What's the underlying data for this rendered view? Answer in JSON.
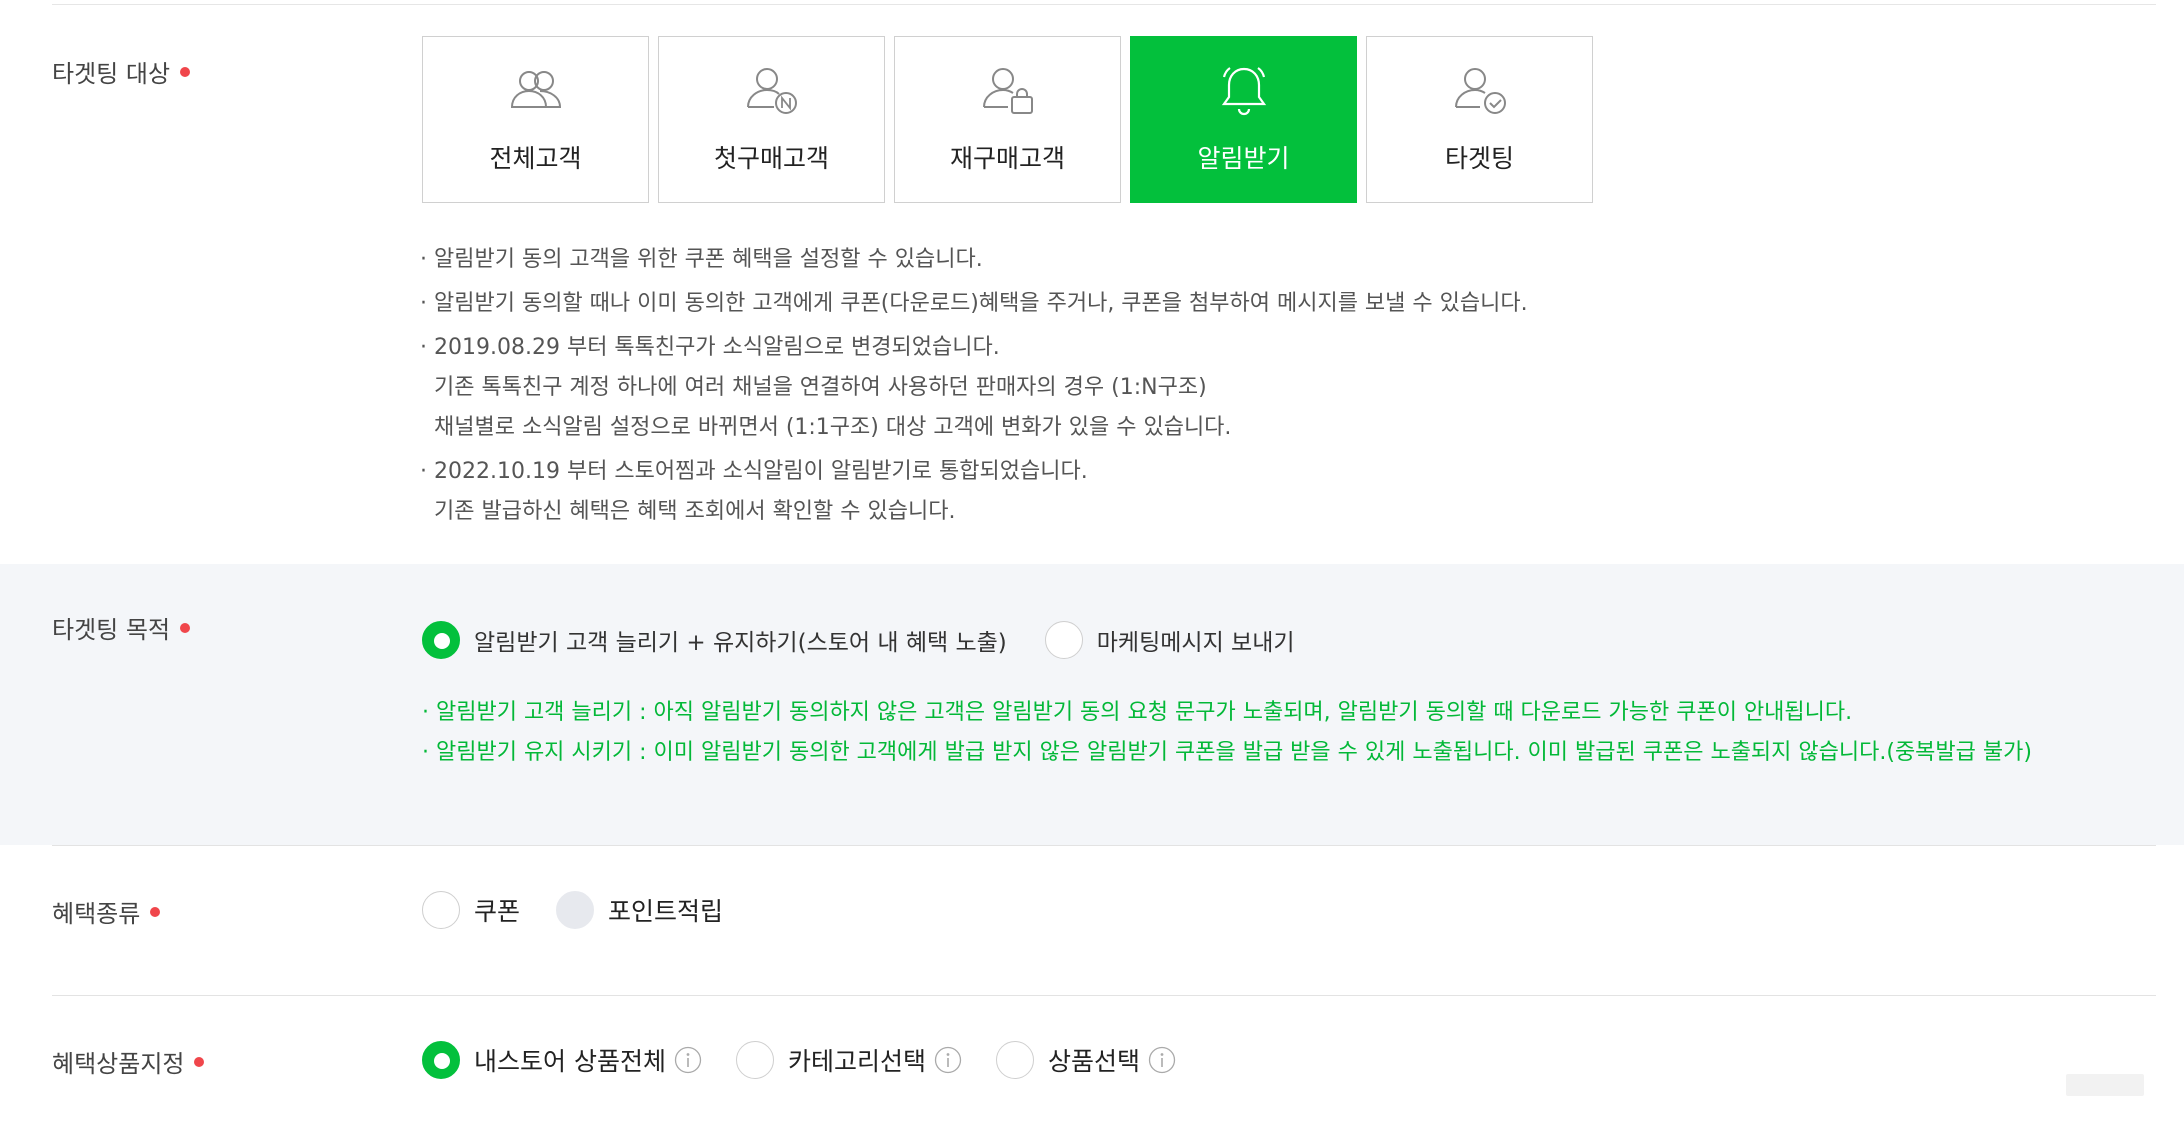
{
  "targeting_target": {
    "label": "타겟팅 대상",
    "cards": [
      {
        "label": "전체고객",
        "icon": "users-icon",
        "active": false
      },
      {
        "label": "첫구매고객",
        "icon": "user-new-icon",
        "active": false
      },
      {
        "label": "재구매고객",
        "icon": "user-bag-icon",
        "active": false
      },
      {
        "label": "알림받기",
        "icon": "bell-icon",
        "active": true
      },
      {
        "label": "타겟팅",
        "icon": "user-check-icon",
        "active": false
      }
    ],
    "notes": [
      "알림받기 동의 고객을 위한 쿠폰 혜택을 설정할 수 있습니다.",
      "알림받기 동의할 때나 이미 동의한 고객에게 쿠폰(다운로드)혜택을 주거나, 쿠폰을 첨부하여 메시지를 보낼 수 있습니다.",
      "2019.08.29 부터 톡톡친구가 소식알림으로 변경되었습니다.",
      "기존 톡톡친구 계정 하나에 여러 채널을 연결하여 사용하던 판매자의 경우 (1:N구조)",
      "채널별로 소식알림 설정으로 바뀌면서 (1:1구조) 대상 고객에 변화가 있을 수 있습니다.",
      "2022.10.19 부터 스토어찜과 소식알림이 알림받기로 통합되었습니다.",
      "기존 발급하신 혜택은 혜택 조회에서 확인할 수 있습니다."
    ]
  },
  "targeting_purpose": {
    "label": "타겟팅 목적",
    "options": [
      {
        "label": "알림받기 고객 늘리기 + 유지하기(스토어 내 혜택 노출)",
        "selected": true
      },
      {
        "label": "마케팅메시지 보내기",
        "selected": false
      }
    ],
    "hints": [
      "· 알림받기 고객 늘리기 : 아직 알림받기 동의하지 않은 고객은 알림받기 동의 요청 문구가 노출되며, 알림받기 동의할 때 다운로드 가능한 쿠폰이 안내됩니다.",
      "· 알림받기 유지 시키기 : 이미 알림받기 동의한 고객에게 발급 받지 않은 알림받기 쿠폰을 발급 받을 수 있게 노출됩니다. 이미 발급된 쿠폰은 노출되지 않습니다.(중복발급 불가)"
    ]
  },
  "benefit_type": {
    "label": "혜택종류",
    "options": [
      {
        "label": "쿠폰",
        "selected": false,
        "disabled": false
      },
      {
        "label": "포인트적립",
        "selected": false,
        "disabled": true
      }
    ]
  },
  "benefit_products": {
    "label": "혜택상품지정",
    "options": [
      {
        "label": "내스토어 상품전체",
        "selected": true
      },
      {
        "label": "카테고리선택",
        "selected": false
      },
      {
        "label": "상품선택",
        "selected": false
      }
    ]
  },
  "colors": {
    "accent": "#03c03c",
    "required_dot": "#f0464b",
    "hint_green": "#03b838",
    "gray_bg": "#f4f6f9"
  }
}
